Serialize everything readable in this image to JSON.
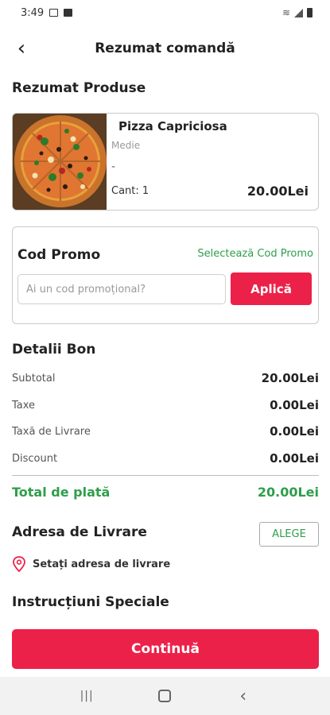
{
  "status_bar": {
    "time": "3:49"
  },
  "header": {
    "title": "Rezumat comandă",
    "back_icon": "‹"
  },
  "products_section": {
    "title": "Rezumat Produse"
  },
  "product": {
    "name": "Pizza Capriciosa",
    "size": "Medie",
    "extras": "-",
    "quantity": "Cant: 1",
    "price": "20.00Lei",
    "image": "pizza-image"
  },
  "promo": {
    "title": "Cod Promo",
    "select_label": "Selectează Cod Promo",
    "input_placeholder": "Ai un cod promoțional?",
    "apply_label": "Aplică"
  },
  "bill": {
    "title": "Detalii Bon",
    "rows": [
      {
        "label": "Subtotal",
        "value": "20.00Lei"
      },
      {
        "label": "Taxe",
        "value": "0.00Lei"
      },
      {
        "label": "Taxă de Livrare",
        "value": "0.00Lei"
      },
      {
        "label": "Discount",
        "value": "0.00Lei"
      }
    ],
    "total_label": "Total de plată",
    "total_value": "20.00Lei"
  },
  "address": {
    "title": "Adresa de Livrare",
    "choose_label": "ALEGE",
    "set_label": "Setați adresa de livrare"
  },
  "instructions": {
    "title": "Instrucțiuni Speciale"
  },
  "continue_label": "Continuă",
  "nav": {
    "recents_icon": "|||",
    "home_icon": "○",
    "back_icon": "‹"
  },
  "colors": {
    "accent": "#ec2149",
    "green": "#2e9e4a"
  }
}
